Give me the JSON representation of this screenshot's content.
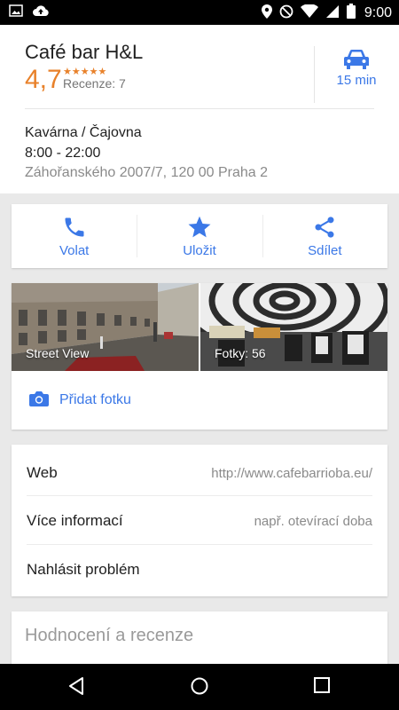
{
  "status_bar": {
    "time": "9:00",
    "icons": [
      "image-icon",
      "cloud-upload-icon",
      "location-icon",
      "do-not-disturb-icon",
      "wifi-icon",
      "signal-icon",
      "battery-icon"
    ]
  },
  "place": {
    "name": "Café bar H&L",
    "rating": "4,7",
    "stars": "★★★★★",
    "reviews": "Recenze: 7",
    "category": "Kavárna / Čajovna",
    "hours": "8:00 - 22:00",
    "address": "Záhořanského 2007/7, 120 00 Praha 2"
  },
  "drive": {
    "time": "15 min",
    "icon": "car-icon"
  },
  "actions": [
    {
      "label": "Volat",
      "icon": "phone-icon"
    },
    {
      "label": "Uložit",
      "icon": "star-icon"
    },
    {
      "label": "Sdílet",
      "icon": "share-icon"
    }
  ],
  "photos": {
    "street_view_label": "Street View",
    "photos_label": "Fotky: 56",
    "add_photo_label": "Přidat fotku"
  },
  "info": [
    {
      "label": "Web",
      "value": "http://www.cafebarrioba.eu/"
    },
    {
      "label": "Více informací",
      "value": "např. otevírací doba"
    },
    {
      "label": "Nahlásit problém",
      "value": ""
    }
  ],
  "reviews_section": {
    "title": "Hodnocení a recenze"
  },
  "colors": {
    "accent": "#3b78e7",
    "rating": "#e8812a"
  }
}
